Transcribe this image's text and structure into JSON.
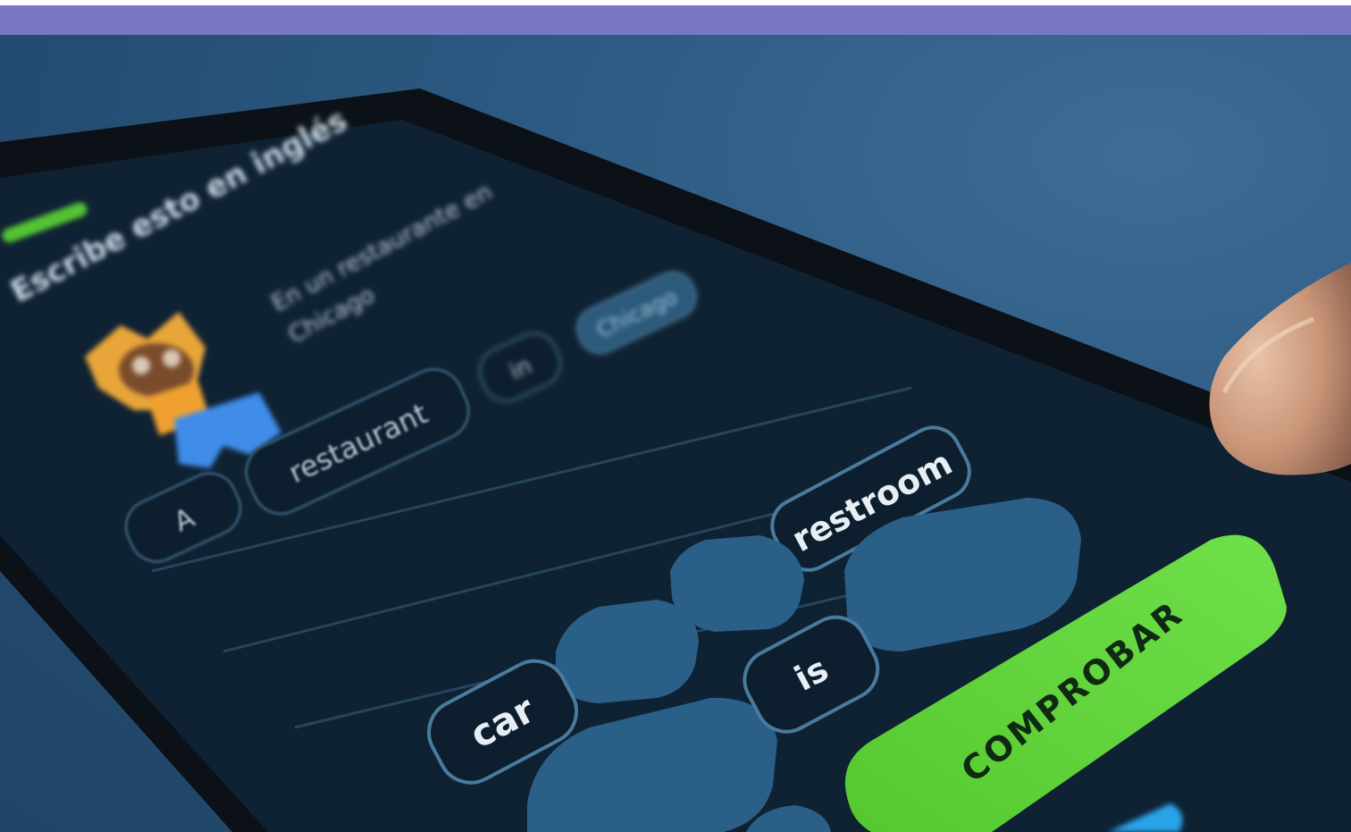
{
  "banner": {
    "color": "#7a78c2"
  },
  "app": {
    "header_text": "Escribe esto en inglés",
    "prompt_line1": "En un restaurante en",
    "prompt_line2": "Chicago",
    "answer_chips": [
      "A",
      "restaurant",
      "in",
      "Chicago"
    ],
    "word_bank": [
      "restroom",
      "is",
      "car"
    ],
    "empty_slots": 5,
    "check_button_label": "COMPROBAR",
    "colors": {
      "check_button": "#5fd13a",
      "screen_bg": "#0f2234",
      "chip_border": "#4a7a9c",
      "empty_slot": "#2a5f88",
      "progress": "#53c234"
    }
  },
  "icons": [
    "character-icon"
  ]
}
